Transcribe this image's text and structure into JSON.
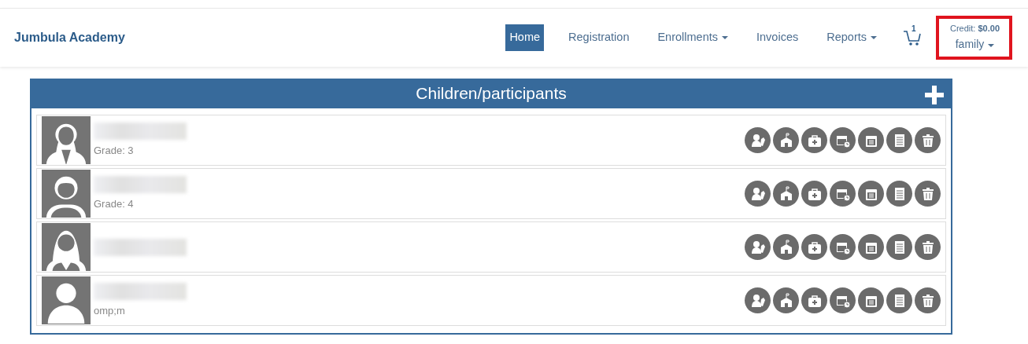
{
  "brand": "Jumbula Academy",
  "nav": [
    {
      "label": "Home",
      "selected": true,
      "dropdown": false
    },
    {
      "label": "Registration",
      "selected": false,
      "dropdown": false
    },
    {
      "label": "Enrollments",
      "selected": false,
      "dropdown": true
    },
    {
      "label": "Invoices",
      "selected": false,
      "dropdown": false
    },
    {
      "label": "Reports",
      "selected": false,
      "dropdown": true
    }
  ],
  "cart": {
    "count": "1"
  },
  "account": {
    "credit": "Credit: **$0.00**",
    "label": "family",
    "dropdown": true,
    "highlighted": true
  },
  "panel": {
    "title": "Children/participants",
    "participants": [
      {
        "kind": "female",
        "name_redacted": true,
        "detail": "Grade: 3"
      },
      {
        "kind": "male",
        "name_redacted": true,
        "detail": "Grade: 4"
      },
      {
        "kind": "female-tie",
        "name_redacted": true
      },
      {
        "kind": "generic",
        "name_redacted": true,
        "detail": "omp;m"
      }
    ]
  }
}
